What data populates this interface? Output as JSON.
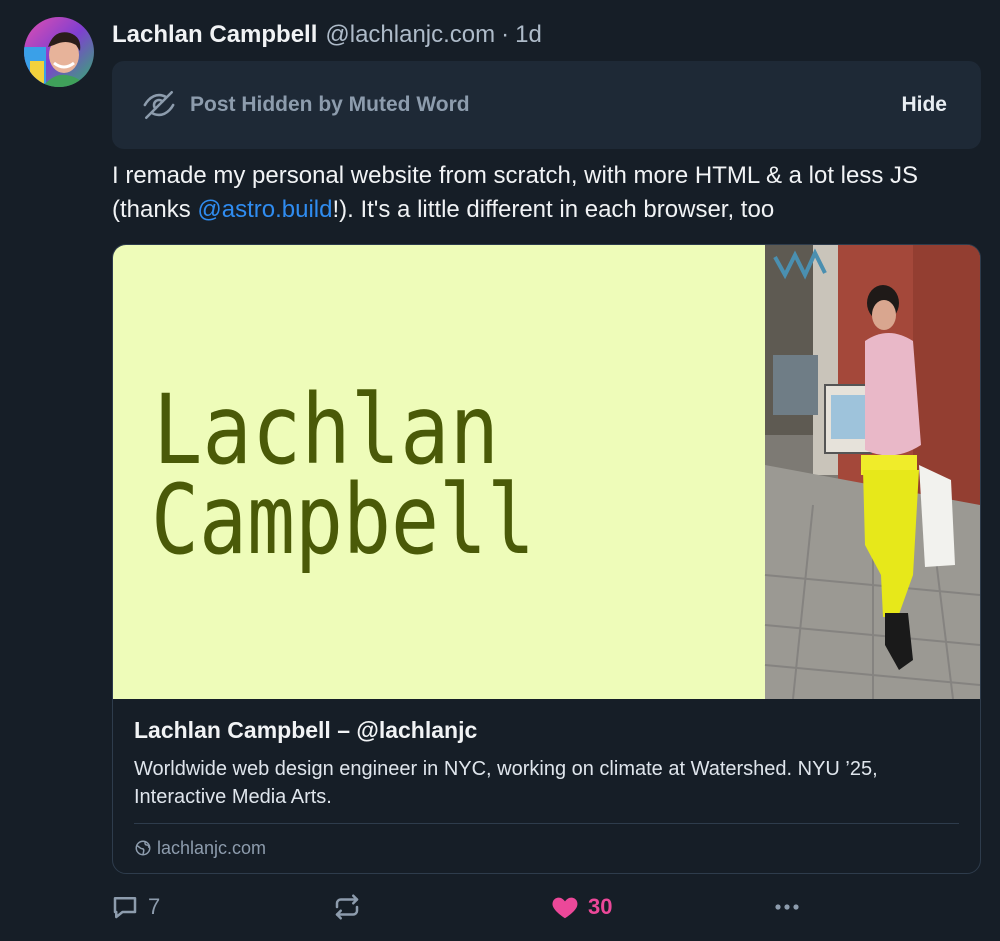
{
  "author": {
    "display_name": "Lachlan Campbell",
    "handle": "@lachlanjc.com",
    "separator": "·",
    "time_ago": "1d"
  },
  "muted_notice": {
    "label": "Post Hidden by Muted Word",
    "hide_label": "Hide",
    "icon": "eye-slash-icon"
  },
  "post": {
    "text_before": "I remade my personal website from scratch, with more HTML & a lot less JS (thanks ",
    "mention": "@astro.build",
    "text_after": "!). It's a little different in each browser, too"
  },
  "link_card": {
    "image_text_line1": "Lachlan",
    "image_text_line2": "Campbell",
    "title": "Lachlan Campbell – @lachlanjc",
    "description": "Worldwide web design engineer in NYC, working on climate at Watershed. NYU ’25, Interactive Media Arts.",
    "domain": "lachlanjc.com"
  },
  "actions": {
    "reply_count": "7",
    "repost_count": "",
    "like_count": "30",
    "icons": [
      "reply-icon",
      "repost-icon",
      "heart-icon",
      "more-icon"
    ]
  },
  "colors": {
    "background": "#161e27",
    "accent_link": "#2f8cf0",
    "like": "#ec4899",
    "card_image_bg": "#eefcb9",
    "card_image_text": "#4a5a08"
  }
}
